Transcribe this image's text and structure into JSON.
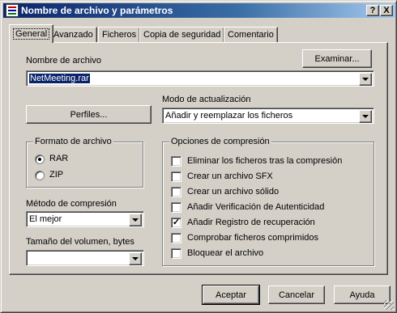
{
  "window": {
    "title": "Nombre de archivo y parámetros",
    "help_button": "?",
    "close_button": "X"
  },
  "tabs": [
    {
      "label": "General",
      "active": true
    },
    {
      "label": "Avanzado",
      "active": false
    },
    {
      "label": "Ficheros",
      "active": false
    },
    {
      "label": "Copia de seguridad",
      "active": false
    },
    {
      "label": "Comentario",
      "active": false
    }
  ],
  "general": {
    "filename_label": "Nombre de archivo",
    "browse_button": "Examinar...",
    "filename_value": "NetMeeting.rar",
    "profiles_button": "Perfiles...",
    "update_mode_label": "Modo de actualización",
    "update_mode_value": "Añadir y reemplazar los ficheros",
    "format_group": "Formato de archivo",
    "format_options": [
      {
        "label": "RAR",
        "selected": true
      },
      {
        "label": "ZIP",
        "selected": false
      }
    ],
    "method_label": "Método de compresión",
    "method_value": "El mejor",
    "volume_label": "Tamaño del volumen, bytes",
    "volume_value": "",
    "options_group": "Opciones de compresión",
    "options": [
      {
        "label": "Eliminar los ficheros tras la compresión",
        "checked": false
      },
      {
        "label": "Crear un archivo SFX",
        "checked": false
      },
      {
        "label": "Crear un archivo sólido",
        "checked": false
      },
      {
        "label": "Añadir Verificación de Autenticidad",
        "checked": false
      },
      {
        "label": "Añadir Registro de recuperación",
        "checked": true
      },
      {
        "label": "Comprobar ficheros comprimidos",
        "checked": false
      },
      {
        "label": "Bloquear el archivo",
        "checked": false
      }
    ]
  },
  "footer": {
    "ok_button": "Aceptar",
    "cancel_button": "Cancelar",
    "help_button": "Ayuda"
  }
}
